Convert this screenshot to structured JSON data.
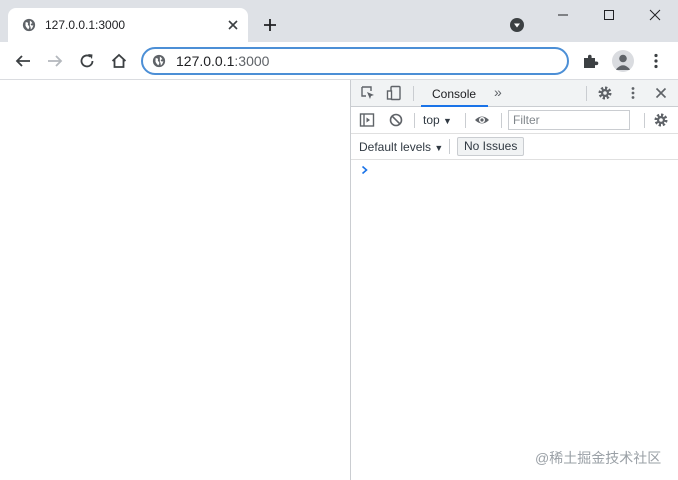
{
  "tab": {
    "title": "127.0.0.1:3000",
    "favicon": "globe-icon"
  },
  "omnibox": {
    "host": "127.0.0.1",
    "port": ":3000"
  },
  "devtools": {
    "tabs": [
      {
        "label": "Console",
        "active": true
      }
    ],
    "more_tabs": "»",
    "context": "top",
    "context_arrow": "▼",
    "filter_placeholder": "Filter",
    "levels": "Default levels",
    "levels_arrow": "▼",
    "issues": "No Issues"
  },
  "watermark": "@稀土掘金技术社区",
  "colors": {
    "accent": "#1a73e8",
    "omnibox_border": "#4c8fd6",
    "titlebar": "#dee1e6",
    "prompt": "#1a73e8"
  }
}
